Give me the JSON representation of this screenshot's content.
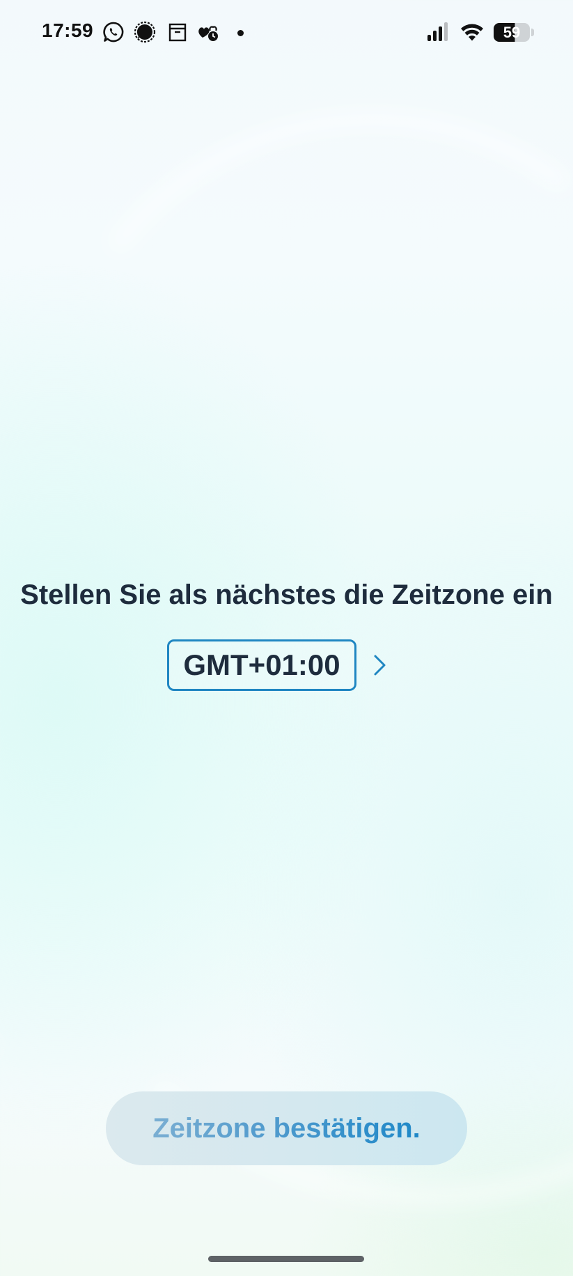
{
  "status_bar": {
    "time": "17:59",
    "battery_level": "59",
    "notification_icons": [
      "whatsapp-icon",
      "signal-messenger-icon",
      "archive-box-icon",
      "hearts-clock-icon",
      "more-notifications-dot"
    ],
    "system_icons": [
      "cellular-signal-icon",
      "wifi-icon",
      "battery-icon"
    ]
  },
  "main": {
    "title": "Stellen Sie als nächstes die Zeitzone ein",
    "timezone_value": "GMT+01:00"
  },
  "footer": {
    "confirm_label": "Zeitzone bestätigen."
  },
  "colors": {
    "accent": "#1f86c2",
    "text_dark": "#1e2c3d",
    "button_bg": "#d4e8ef"
  }
}
